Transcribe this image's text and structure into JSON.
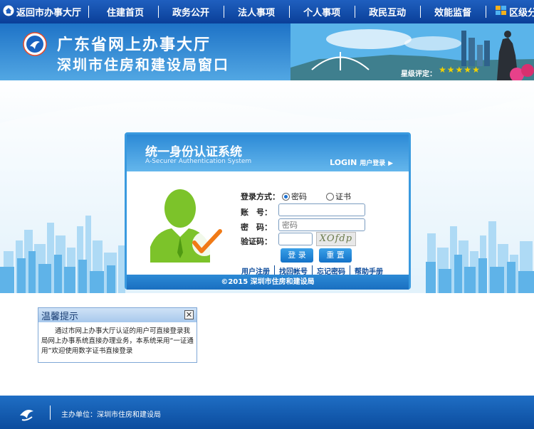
{
  "nav": {
    "back": "返回市办事大厅",
    "items": [
      "住建首页",
      "政务公开",
      "法人事项",
      "个人事项",
      "政民互动",
      "效能监督"
    ],
    "district": "区级分厅"
  },
  "banner": {
    "title_line1": "广东省网上办事大厅",
    "title_line2": "深圳市住房和建设局窗口",
    "rating_label": "星级评定："
  },
  "login": {
    "title": "统一身份认证系统",
    "subtitle": "A-Securer Authentication System",
    "login_en": "LOGIN",
    "login_cn": "用户登录",
    "method_label": "登录方式：",
    "method_password": "密码",
    "method_cert": "证书",
    "account_label": "账　号：",
    "password_label": "密　码：",
    "password_placeholder": "密码",
    "captcha_label": "验证码：",
    "captcha_text": "XOfdp",
    "login_button": "登 录",
    "reset_button": "重 置",
    "links": [
      "用户注册",
      "找回帐号",
      "忘记密码",
      "帮助手册"
    ],
    "copyright": "©2015 深圳市住房和建设局"
  },
  "tip": {
    "title": "温馨提示",
    "body": "通过市网上办事大厅认证的用户可直接登录我局网上办事系统直接办理业务，本系统采用“一证通用”欢迎使用数字证书直接登录"
  },
  "footer": {
    "text": "主办单位：深圳市住房和建设局"
  },
  "colors": {
    "nav_bg": "#0a3f98",
    "accent": "#2c8ad6",
    "check": "#f07a16",
    "avatar": "#7cc32a"
  }
}
